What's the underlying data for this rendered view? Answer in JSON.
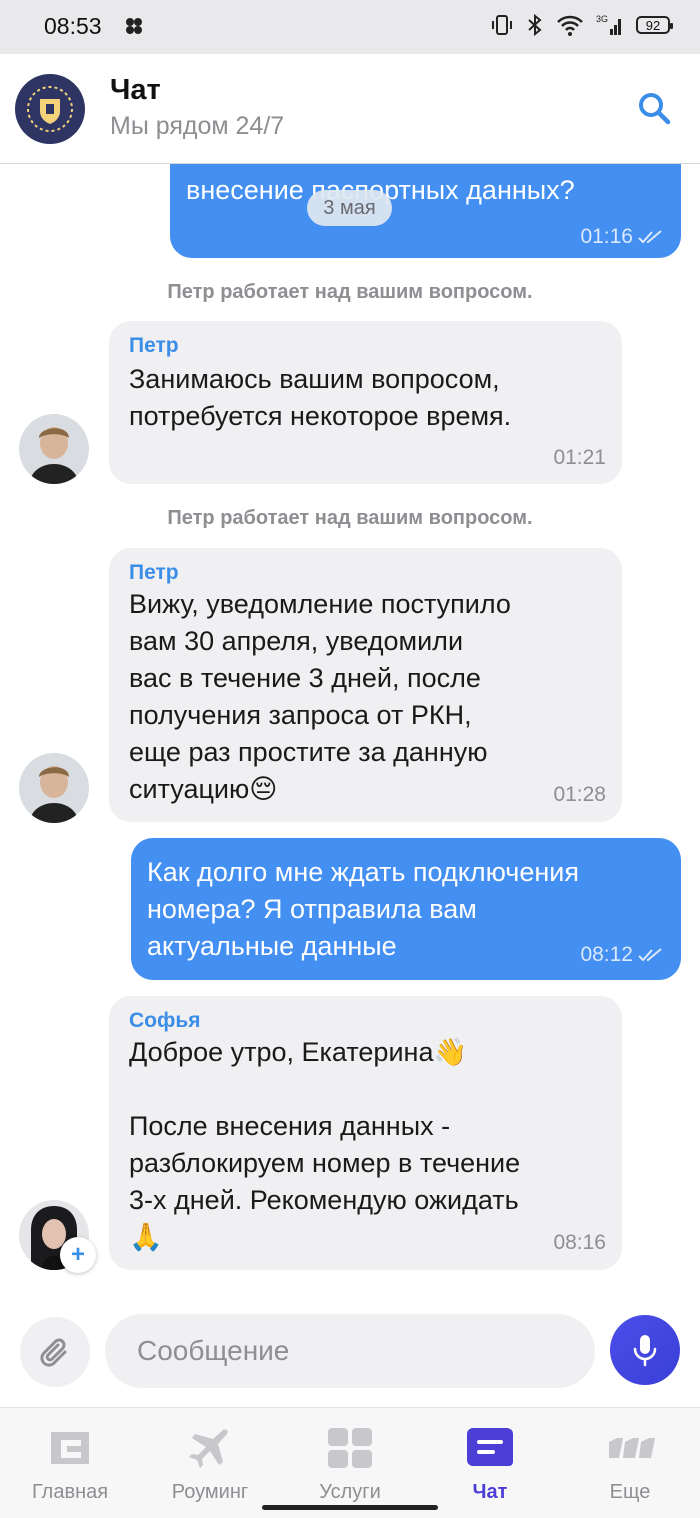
{
  "status_bar": {
    "time": "08:53",
    "battery": "92",
    "network": "3G"
  },
  "header": {
    "title": "Чат",
    "subtitle": "Мы рядом 24/7"
  },
  "chat": {
    "date_separator": "3 мая",
    "messages": [
      {
        "type": "outgoing",
        "text": "внесение паспортных данных?",
        "time": "01:16"
      },
      {
        "type": "system",
        "text": "Петр работает над вашим вопросом."
      },
      {
        "type": "incoming",
        "sender": "Петр",
        "text": "Занимаюсь вашим вопросом,\nпотребуется некоторое время.",
        "time": "01:21"
      },
      {
        "type": "system",
        "text": "Петр работает над вашим вопросом."
      },
      {
        "type": "incoming",
        "sender": "Петр",
        "text": "Вижу, уведомление поступило\nвам 30 апреля, уведомили\nвас в течение 3 дней, после\nполучения запроса от РКН,\nеще раз простите за данную\nситуацию😔",
        "time": "01:28"
      },
      {
        "type": "outgoing",
        "text": "Как долго мне ждать подключения\nномера? Я отправила вам\nактуальные данные",
        "time": "08:12"
      },
      {
        "type": "incoming",
        "sender": "Софья",
        "text": "Доброе утро, Екатерина👋\n\nПосле внесения данных -\nразблокируем номер в течение\n3-х дней. Рекомендую ожидать\n🙏",
        "time": "08:16"
      }
    ]
  },
  "composer": {
    "placeholder": "Сообщение"
  },
  "nav": {
    "items": [
      {
        "label": "Главная",
        "icon": "home-icon"
      },
      {
        "label": "Роуминг",
        "icon": "plane-icon"
      },
      {
        "label": "Услуги",
        "icon": "services-grid-icon"
      },
      {
        "label": "Чат",
        "icon": "chat-icon",
        "active": true
      },
      {
        "label": "Еще",
        "icon": "more-icon"
      }
    ]
  },
  "colors": {
    "accent": "#438ff2",
    "active_nav": "#4c3fd6",
    "mic": "#3f43de"
  }
}
